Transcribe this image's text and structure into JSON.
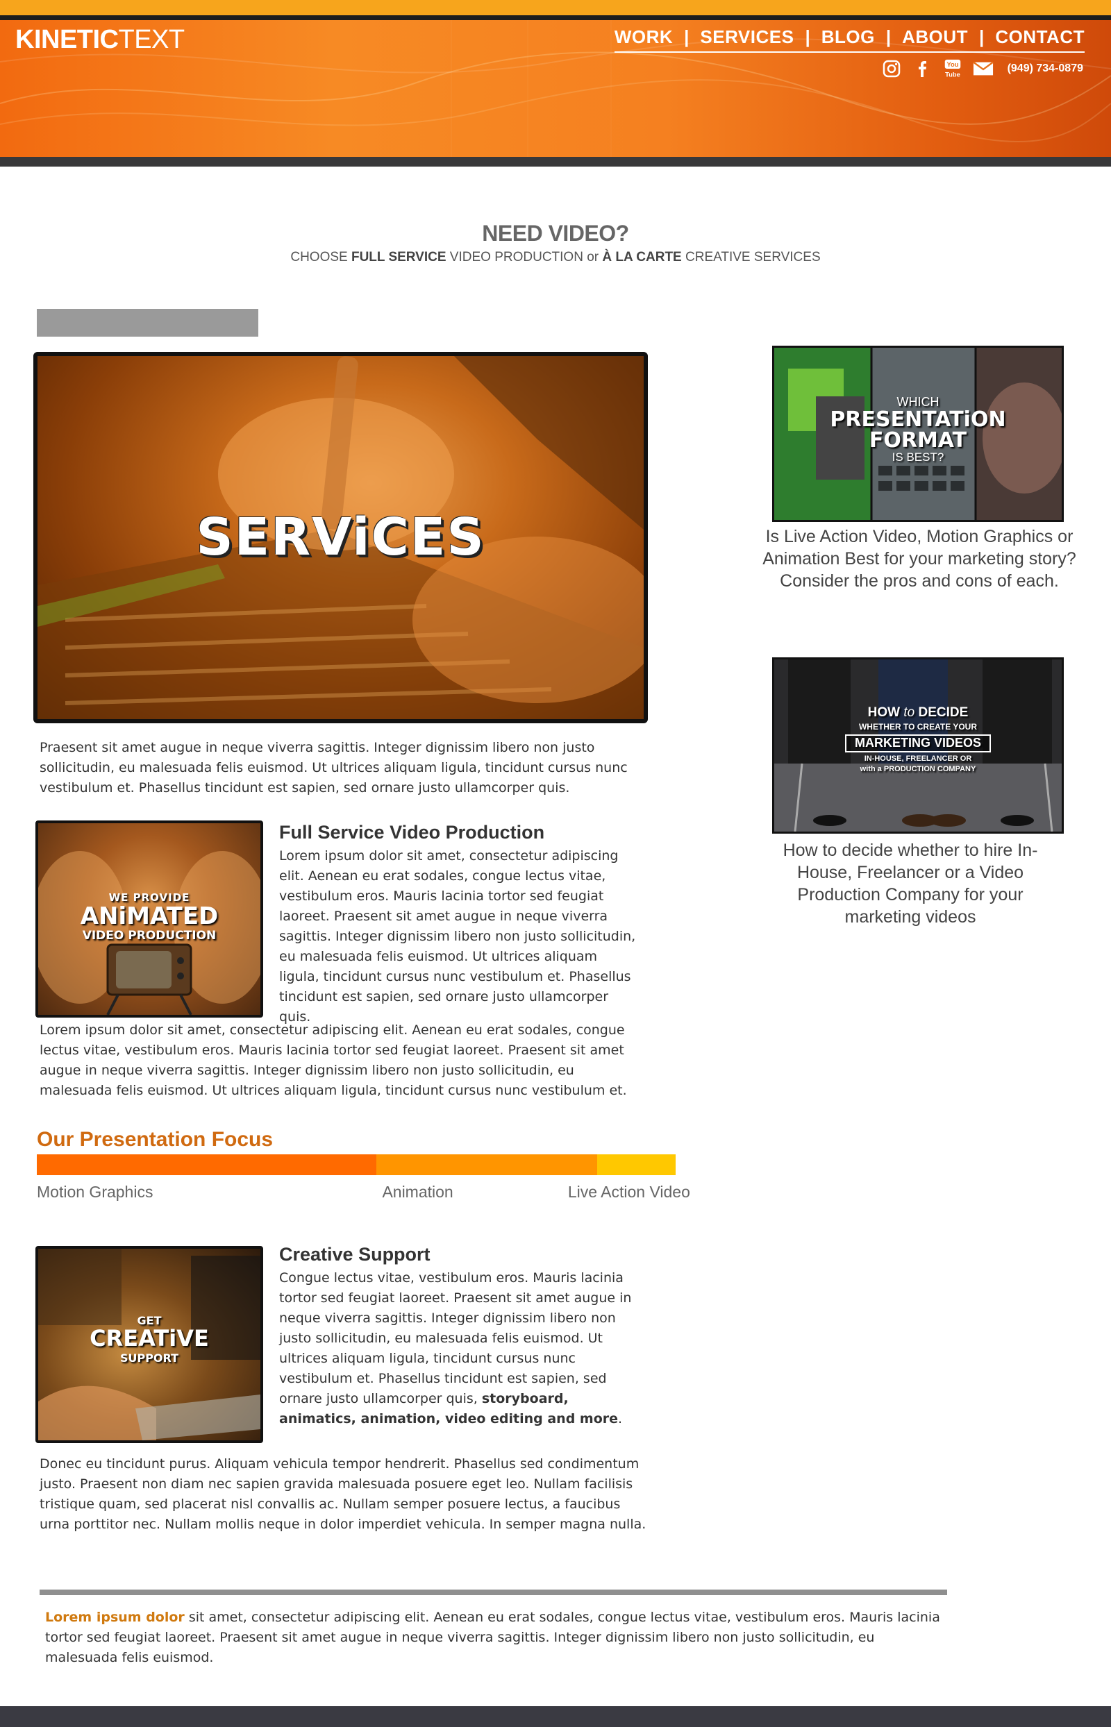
{
  "header": {
    "logo_bold": "KINETIC",
    "logo_light": "TEXT",
    "nav": [
      "WORK",
      "SERVICES",
      "BLOG",
      "ABOUT",
      "CONTACT"
    ],
    "social_icons": [
      "instagram-icon",
      "facebook-icon",
      "youtube-icon",
      "email-icon"
    ],
    "youtube_text_top": "You",
    "youtube_text_bottom": "Tube",
    "phone": "(949) 734-0879"
  },
  "intro": {
    "title": "NEED VIDEO?",
    "sub_part1": "CHOOSE ",
    "sub_bold1": "FULL SERVICE",
    "sub_part2": " VIDEO PRODUCTION or ",
    "sub_bold2": "À LA CARTE",
    "sub_part3": " CREATIVE SERVICES"
  },
  "hero": {
    "title": "SERViCES",
    "intro_text": "Praesent sit amet augue in neque viverra sagittis. Integer dignissim libero non justo sollicitudin, eu malesuada felis euismod. Ut ultrices aliquam ligula, tincidunt cursus nunc vestibulum et. Phasellus tincidunt est sapien, sed ornare justo ullamcorper quis."
  },
  "full_service": {
    "thumb_line1": "WE PROVIDE",
    "thumb_line2": "ANiMATED",
    "thumb_line3": "VIDEO PRODUCTION",
    "heading": "Full Service Video Production",
    "text": "Lorem ipsum dolor sit amet, consectetur adipiscing elit. Aenean eu erat sodales, congue lectus vitae, vestibulum eros. Mauris lacinia tortor sed feugiat laoreet. Praesent sit amet augue in neque viverra sagittis. Integer dignissim libero non justo sollicitudin, eu malesuada felis euismod. Ut ultrices aliquam ligula, tincidunt cursus nunc vestibulum et. Phasellus tincidunt est sapien, sed ornare justo ullamcorper quis.",
    "text2": "Lorem ipsum dolor sit amet, consectetur adipiscing elit. Aenean eu erat sodales, congue lectus vitae, vestibulum eros. Mauris lacinia tortor sed feugiat laoreet. Praesent sit amet augue in neque viverra sagittis. Integer dignissim libero non justo sollicitudin, eu malesuada felis euismod. Ut ultrices aliquam ligula, tincidunt cursus nunc vestibulum et."
  },
  "focus": {
    "title": "Our Presentation Focus",
    "segments": [
      {
        "label": "Motion Graphics",
        "share": 0.532,
        "color": "#ff6a00"
      },
      {
        "label": "Animation",
        "share": 0.345,
        "color": "#ff9500"
      },
      {
        "label": "Live Action Video",
        "share": 0.123,
        "color": "#ffc800"
      }
    ]
  },
  "creative": {
    "thumb_line1": "GET",
    "thumb_line2": "CREATiVE",
    "thumb_line3": "SUPPORT",
    "heading": "Creative Support",
    "text_plain": "Congue lectus vitae, vestibulum eros. Mauris lacinia tortor sed feugiat laoreet. Praesent sit amet augue in neque viverra sagittis. Integer dignissim libero non justo sollicitudin, eu malesuada felis euismod. Ut ultrices aliquam ligula, tincidunt cursus nunc vestibulum et. Phasellus tincidunt est sapien, sed ornare justo ullamcorper quis, ",
    "text_bold": "storyboard, animatics, animation, video editing and more",
    "text_end": ".",
    "text2": "Donec eu tincidunt purus. Aliquam vehicula tempor hendrerit. Phasellus sed condimentum justo. Praesent non diam nec sapien gravida malesuada posuere eget leo. Nullam facilisis tristique quam, sed placerat nisl convallis ac. Nullam semper posuere lectus, a faucibus urna porttitor nec. Nullam mollis neque in dolor imperdiet vehicula. In semper magna nulla."
  },
  "footer": {
    "accent": "Lorem ipsum dolor",
    "text": " sit amet, consectetur adipiscing elit. Aenean eu erat sodales, congue lectus vitae, vestibulum eros. Mauris lacinia tortor sed feugiat laoreet. Praesent sit amet augue in neque viverra sagittis. Integer dignissim libero non justo sollicitudin, eu malesuada felis euismod."
  },
  "sidebar": {
    "card1": {
      "img_line1": "WHICH",
      "img_line2": "PRESENTATiON",
      "img_line3": "FORMAT",
      "img_line4": "IS BEST?",
      "caption": "Is Live Action Video, Motion Graphics or Animation Best for your marketing story? Consider the pros and cons of each."
    },
    "card2": {
      "img_line1a": "HOW ",
      "img_line1b": "to",
      "img_line1c": " DECIDE",
      "img_line2": "WHETHER TO CREATE YOUR",
      "img_line3": "MARKETING VIDEOS",
      "img_line4": "IN-HOUSE, FREELANCER OR",
      "img_line5": "with a PRODUCTION COMPANY",
      "caption": "How to decide whether to hire In-House, Freelancer or a Video Production Company for your marketing videos"
    }
  },
  "colors": {
    "accent_orange": "#d06a10",
    "header_orange": "#f78a24",
    "dark_bar": "#38383a"
  }
}
